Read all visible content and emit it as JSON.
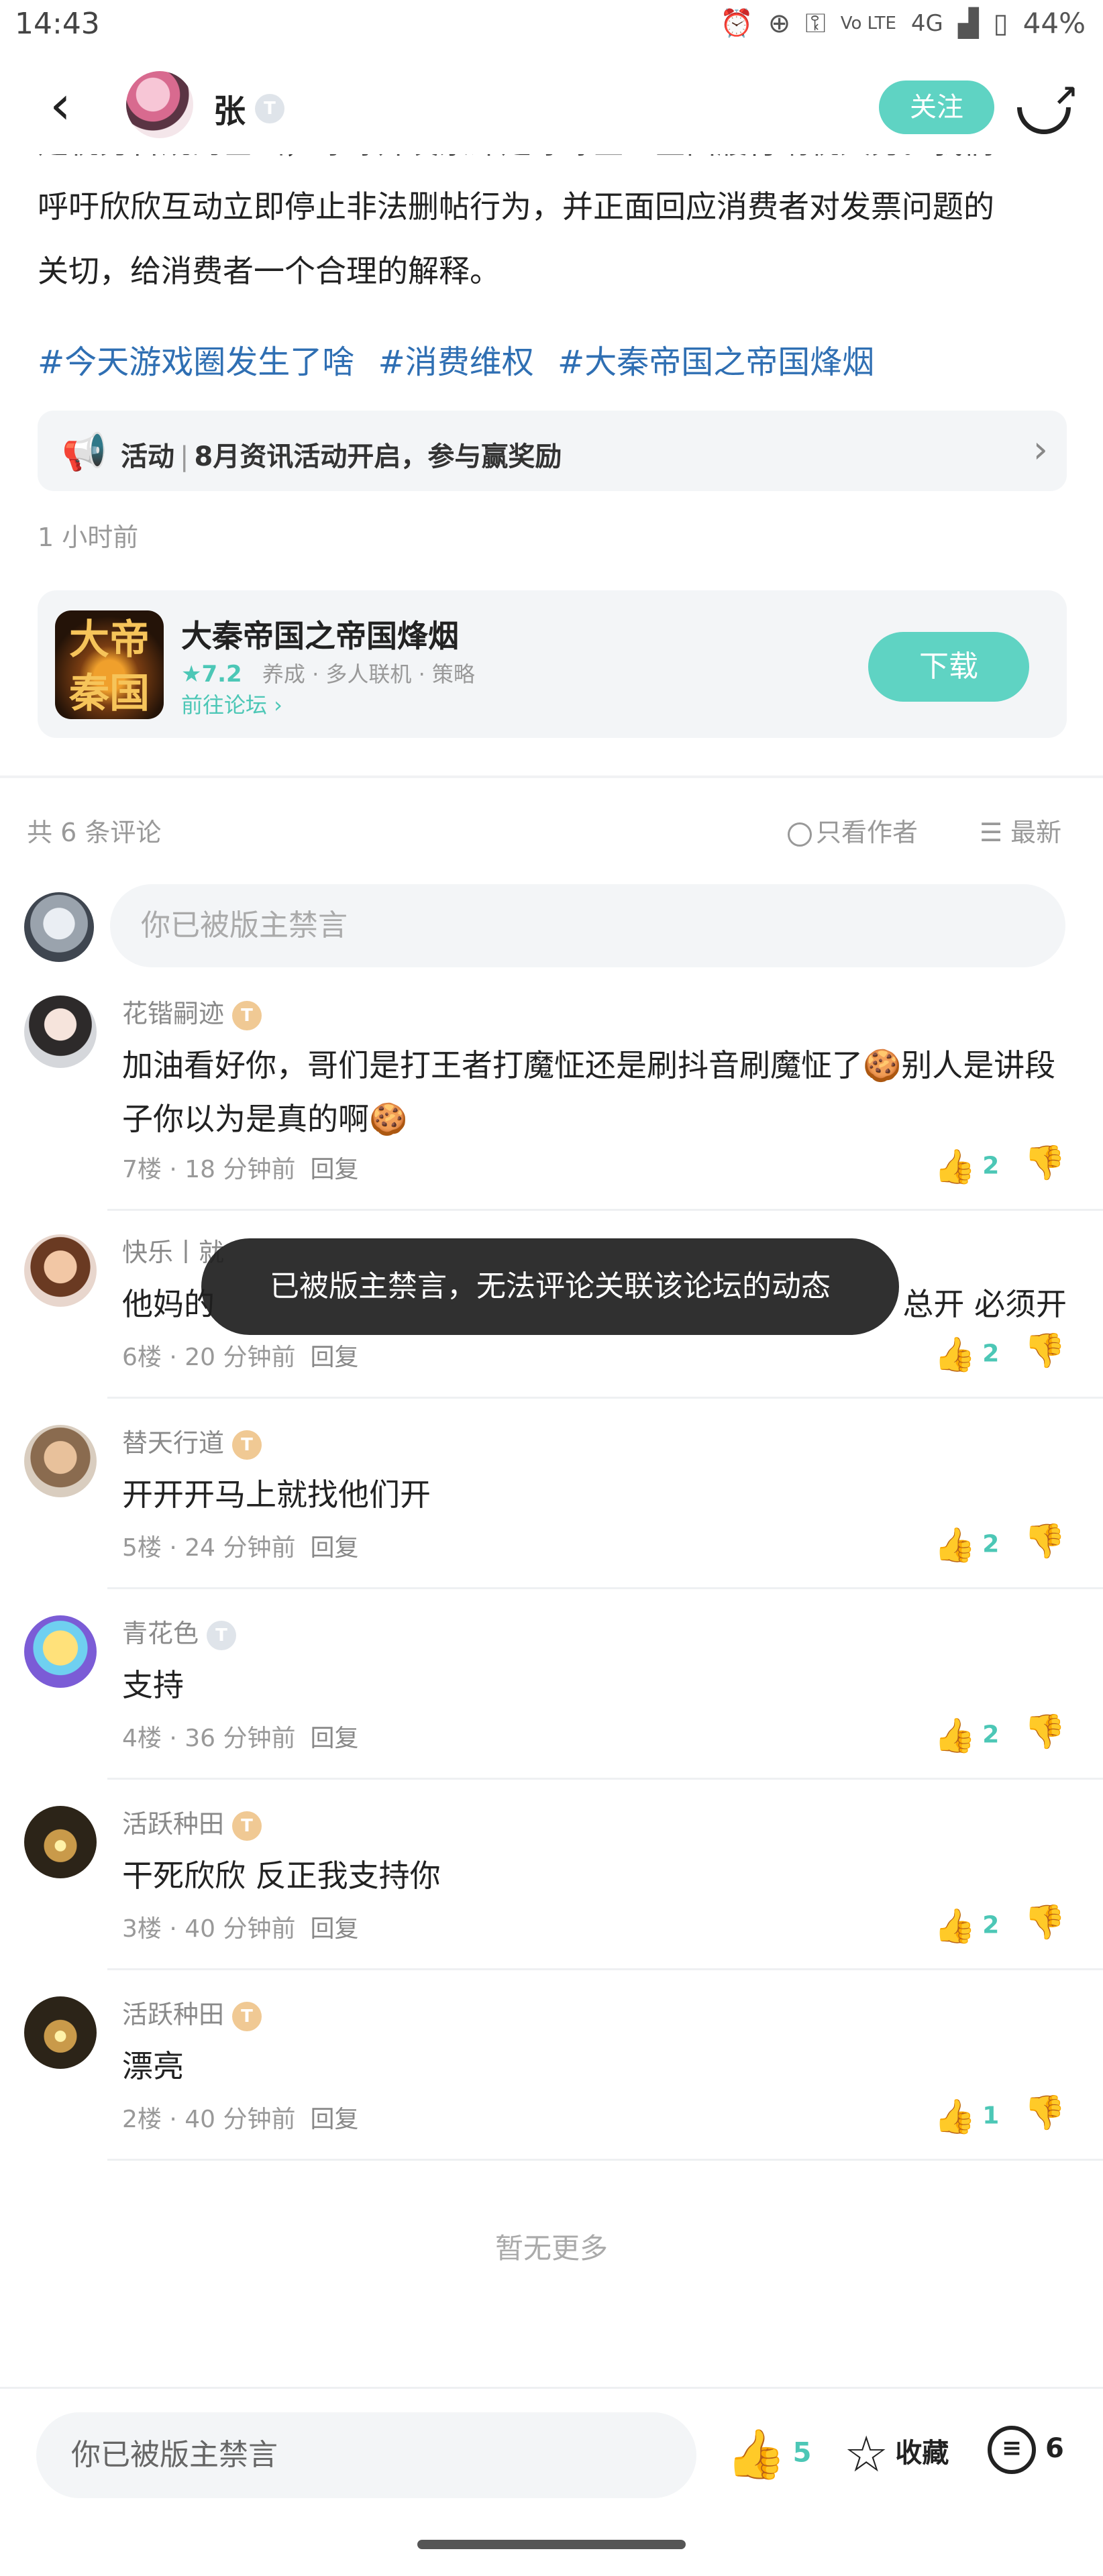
{
  "status_bar": {
    "time": "14:43",
    "network": "4G",
    "volte": "Vo LTE",
    "battery": "44%"
  },
  "header": {
    "back": "‹",
    "user_name": "张",
    "level": "T",
    "follow_label": "关注"
  },
  "article": {
    "lines": [
      "是税务合规的基础，呼吁开发票即是呼吁企业全面履行纳税义务。我们",
      "呼吁欣欣互动立即停止非法删帖行为，并正面回应消费者对发票问题的",
      "关切，给消费者一个合理的解释。"
    ],
    "hashtags": [
      "#今天游戏圈发生了啥",
      "#消费维权",
      "#大秦帝国之帝国烽烟"
    ]
  },
  "activity": {
    "label": "活动",
    "text": "8月资讯活动开启，参与赢奖励"
  },
  "post_time": "1 小时前",
  "game_card": {
    "title": "大秦帝国之帝国烽烟",
    "rating": "★7.2",
    "tags": "养成 · 多人联机 · 策略",
    "forum_link": "前往论坛 ›",
    "download_label": "下载",
    "icon_text": "大帝秦国"
  },
  "comments_section": {
    "count_text": "共 6 条评论",
    "only_author": "只看作者",
    "sort": "最新",
    "input_placeholder": "你已被版主禁言"
  },
  "comments": [
    {
      "name": "花锴嗣迹",
      "level": "T",
      "text": "加油看好你，哥们是打王者打魔怔还是刷抖音刷魔怔了🍪别人是讲段子你以为是真的啊🍪",
      "floor": "7楼 · 18 分钟前",
      "reply": "回复",
      "likes": "2"
    },
    {
      "name": "快乐丨就",
      "level": "",
      "text": "他妈的",
      "text_right": "总开 必须开",
      "floor": "6楼 · 20 分钟前",
      "reply": "回复",
      "likes": "2"
    },
    {
      "name": "替天行道",
      "level": "T",
      "text": "开开开马上就找他们开",
      "floor": "5楼 · 24 分钟前",
      "reply": "回复",
      "likes": "2"
    },
    {
      "name": "青花色",
      "level": "T",
      "text": "支持",
      "floor": "4楼 · 36 分钟前",
      "reply": "回复",
      "likes": "2"
    },
    {
      "name": "活跃种田",
      "level": "T",
      "text": "干死欣欣 反正我支持你",
      "floor": "3楼 · 40 分钟前",
      "reply": "回复",
      "likes": "2"
    },
    {
      "name": "活跃种田",
      "level": "T",
      "text": "漂亮",
      "floor": "2楼 · 40 分钟前",
      "reply": "回复",
      "likes": "1"
    }
  ],
  "toast": "已被版主禁言，无法评论关联该论坛的动态",
  "no_more": "暂无更多",
  "bottom_bar": {
    "input_placeholder": "你已被版主禁言",
    "likes": "5",
    "favorite_label": "收藏",
    "comments": "6"
  },
  "colors": {
    "accent": "#5fd3c3",
    "link": "#2f6fb3",
    "like": "#4cc7b6"
  }
}
